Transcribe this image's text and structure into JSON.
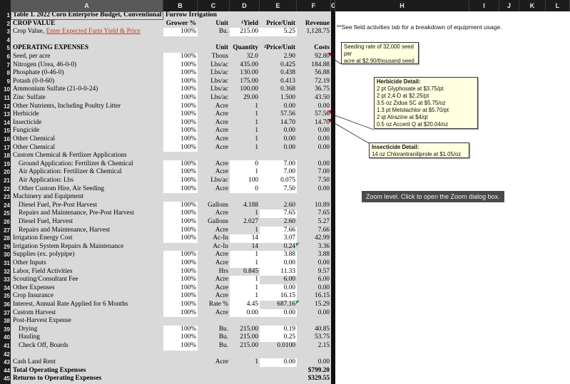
{
  "column_headers": [
    "A",
    "B",
    "C",
    "D",
    "E",
    "F",
    "G",
    "H",
    "I",
    "J",
    "K",
    "L"
  ],
  "row_numbers": [
    "1",
    "2",
    "3",
    "4",
    "5",
    "6",
    "7",
    "8",
    "9",
    "10",
    "11",
    "12",
    "13",
    "14",
    "15",
    "16",
    "17",
    "18",
    "19",
    "20",
    "21",
    "22",
    "23",
    "24",
    "25",
    "26",
    "27",
    "28",
    "29",
    "30",
    "31",
    "32",
    "33",
    "34",
    "35",
    "36",
    "37",
    "38",
    "39",
    "40",
    "41",
    "42",
    "43",
    "44",
    "45"
  ],
  "title_row": {
    "a": "Table 1. 2022 Corn Enterprise Budget, Conventional",
    "b": "Furrow Irrigation"
  },
  "crop_value_header": {
    "label": "CROP VALUE",
    "grower": "Grower %",
    "unit": "Unit",
    "yield_sup": "1",
    "yield": "Yield",
    "price": "Price/Unit",
    "revenue": "Revenue"
  },
  "crop_value_row": {
    "label": "Crop Value, ",
    "link": "Enter Expected Farm Yield & Price",
    "grower": "100%",
    "unit": "Bu.",
    "yield": "215.00",
    "price": "5.25",
    "revenue": "1,128.75"
  },
  "opex_header": {
    "label": "OPERATING EXPENSES",
    "unit": "Unit",
    "quantity": "Quantity",
    "price_sup": "2",
    "price": "Price/Unit",
    "costs": "Costs"
  },
  "rows": [
    {
      "label": "Seed, per acre",
      "grower": "100%",
      "unit": "Thous",
      "qty": "32.0",
      "price": "2.90",
      "cost": "92.80"
    },
    {
      "label": "Nitrogen (Urea, 46-0-0)",
      "grower": "100%",
      "unit": "Lbs/ac",
      "qty": "435.00",
      "price": "0.425",
      "cost": "184.88"
    },
    {
      "label": "Phosphate (0-46-0)",
      "grower": "100%",
      "unit": "Lbs/ac",
      "qty": "130.00",
      "price": "0.438",
      "cost": "56.88"
    },
    {
      "label": "Potash (0-0-60)",
      "grower": "100%",
      "unit": "Lbs/ac",
      "qty": "175.00",
      "price": "0.413",
      "cost": "72.19"
    },
    {
      "label": "Ammonium Sulfate (21-0-0-24)",
      "grower": "100%",
      "unit": "Lbs/ac",
      "qty": "100.00",
      "price": "0.368",
      "cost": "36.75"
    },
    {
      "label": "Zinc Sulfate",
      "grower": "100%",
      "unit": "Lbs/ac",
      "qty": "29.00",
      "price": "1.500",
      "cost": "43.50"
    },
    {
      "label": "Other Nutrients, Including Poultry Litter",
      "grower": "100%",
      "unit": "Acre",
      "qty": "1",
      "price": "0.00",
      "cost": "0.00"
    },
    {
      "label": "Herbicide",
      "grower": "100%",
      "unit": "Acre",
      "qty": "1",
      "price": "57.56",
      "cost": "57.56"
    },
    {
      "label": "Insecticide",
      "grower": "100%",
      "unit": "Acre",
      "qty": "1",
      "price": "14.70",
      "cost": "14.70"
    },
    {
      "label": "Fungicide",
      "grower": "100%",
      "unit": "Acre",
      "qty": "1",
      "price": "0.00",
      "cost": "0.00"
    },
    {
      "label": "Other Chemical",
      "grower": "100%",
      "unit": "Acre",
      "qty": "1",
      "price": "0.00",
      "cost": "0.00"
    },
    {
      "label": "Other Chemical",
      "grower": "100%",
      "unit": "Acre",
      "qty": "1",
      "price": "0.00",
      "cost": "0.00"
    },
    {
      "label": "Custom Chemical & Fertlizer Applications",
      "grower": "",
      "unit": "",
      "qty": "",
      "price": "",
      "cost": ""
    },
    {
      "label": "Ground Application: Fertilizer & Chemical",
      "grower": "100%",
      "unit": "Acre",
      "qty": "0",
      "price": "7.00",
      "cost": "0.00"
    },
    {
      "label": "Air Application: Fertilizer & Chemical",
      "grower": "100%",
      "unit": "Acre",
      "qty": "1",
      "price": "7.00",
      "cost": "7.00"
    },
    {
      "label": "Air Application: Lbs",
      "grower": "100%",
      "unit": "Lbs/ac",
      "qty": "100",
      "price": "0.075",
      "cost": "7.50"
    },
    {
      "label": "Other Custom Hire, Air Seeding",
      "grower": "100%",
      "unit": "Acre",
      "qty": "0",
      "price": "7.50",
      "cost": "0.00"
    },
    {
      "label": "Machinery and Equipment",
      "grower": "",
      "unit": "",
      "qty": "",
      "price": "",
      "cost": ""
    },
    {
      "label": "Diesel Fuel, Pre-Post Harvest",
      "grower": "100%",
      "unit": "Gallons",
      "qty": "4.188",
      "price": "2.60",
      "cost": "10.89"
    },
    {
      "label": "Repairs and Maintenance, Pre-Post Harvest",
      "grower": "100%",
      "unit": "Acre",
      "qty": "1",
      "price": "7.65",
      "cost": "7.65"
    },
    {
      "label": "Diesel Fuel, Harvest",
      "grower": "100%",
      "unit": "Gallons",
      "qty": "2.027",
      "price": "2.60",
      "cost": "5.27"
    },
    {
      "label": "Repairs and Maintenance, Harvest",
      "grower": "100%",
      "unit": "Acre",
      "qty": "1",
      "price": "7.66",
      "cost": "7.66"
    },
    {
      "label": "Irrigation Energy Cost",
      "grower": "100%",
      "unit": "Ac-In",
      "qty": "14",
      "price": "3.07",
      "cost": "42.99"
    },
    {
      "label": "Irrigation System Repairs & Maintenance",
      "grower": "",
      "unit": "Ac-In",
      "qty": "14",
      "price": "0.24",
      "cost": "3.36"
    },
    {
      "label": "Supplies (ex. polypipe)",
      "grower": "100%",
      "unit": "Acre",
      "qty": "1",
      "price": "3.88",
      "cost": "3.88"
    },
    {
      "label": "Other Inputs",
      "grower": "100%",
      "unit": "Acre",
      "qty": "1",
      "price": "0.00",
      "cost": "0.00"
    },
    {
      "label": "Labor, Field Activities",
      "grower": "100%",
      "unit": "Hrs",
      "qty": "0.845",
      "price": "11.33",
      "cost": "9.57"
    },
    {
      "label": "Scouting/Consultant Fee",
      "grower": "100%",
      "unit": "Acre",
      "qty": "1",
      "price": "6.00",
      "cost": "6.00"
    },
    {
      "label": "Other Expenses",
      "grower": "100%",
      "unit": "Acre",
      "qty": "1",
      "price": "0.00",
      "cost": "0.00"
    },
    {
      "label": "Crop Insurance",
      "grower": "100%",
      "unit": "Acre",
      "qty": "1",
      "price": "16.15",
      "cost": "16.15"
    },
    {
      "label": "Interest, Annual Rate Applied for 6 Months",
      "grower": "100%",
      "unit": "Rate %",
      "qty": "4.45",
      "price": "687.16",
      "cost": "15.29"
    },
    {
      "label": "Custom Harvest",
      "grower": "100%",
      "unit": "Acre",
      "qty": "0.00",
      "price": "0.00",
      "cost": "0.00"
    },
    {
      "label": "Post-Harvest Expense",
      "grower": "",
      "unit": "",
      "qty": "",
      "price": "",
      "cost": ""
    },
    {
      "label": "Drying",
      "grower": "100%",
      "unit": "Bu.",
      "qty": "215.00",
      "price": "0.19",
      "cost": "40.85"
    },
    {
      "label": "Hauling",
      "grower": "100%",
      "unit": "Bu.",
      "qty": "215.00",
      "price": "0.25",
      "cost": "53.75"
    },
    {
      "label": "Check Off, Boards",
      "grower": "100%",
      "unit": "Bu.",
      "qty": "215.00",
      "price": "0.0100",
      "cost": "2.15"
    },
    {
      "label": "",
      "grower": "",
      "unit": "",
      "qty": "",
      "price": "",
      "cost": ""
    },
    {
      "label": "Cash Land Rent",
      "grower": "",
      "unit": "Acre",
      "qty": "1",
      "price": "0.00",
      "cost": "0.00"
    }
  ],
  "totals": {
    "total_label": "Total Operating Expenses",
    "total_value": "$799.20",
    "returns_label": "Returns to Operating Expenses",
    "returns_value": "$329.55"
  },
  "side_note": "**See field activities tab for a breakdown of equipment usage.",
  "comments": {
    "seed": [
      "Seeding rate of 32,000 seed per",
      "acre at $2.90/thousand seed"
    ],
    "herbicide_title": "Herbicide Detail:",
    "herbicide_lines": [
      "2 pt Glyphosate at $3.75/pt",
      "2 pt 2,4-D at $2.25/pt",
      "3.5 oz Zidua SC at $5.75/oz",
      "1.3 pt Metolachlor at $5.70/pt",
      "2 qt Atrazine at $4/qt",
      "0.5 oz Accent Q at $20.04/oz"
    ],
    "insecticide_title": "Insecticide Detail:",
    "insecticide_lines": [
      "14 oz Chlorantraniliprole at $1.05/oz"
    ]
  },
  "tooltip": "Zoom level. Click to open the Zoom dialog box."
}
